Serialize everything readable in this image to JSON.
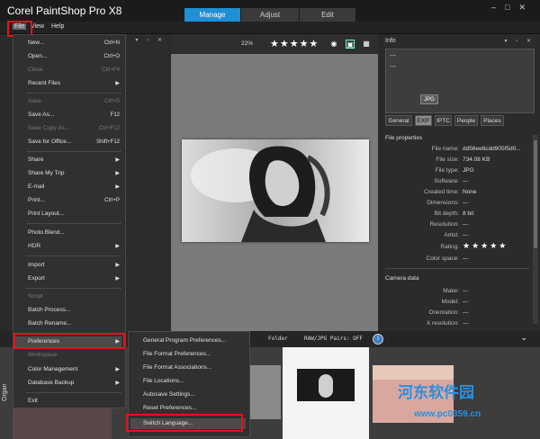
{
  "app": {
    "title": "Corel PaintShop Pro X8"
  },
  "mode_tabs": [
    {
      "label": "Manage",
      "active": true
    },
    {
      "label": "Adjust",
      "active": false
    },
    {
      "label": "Edit",
      "active": false
    }
  ],
  "window_controls": [
    "–",
    "□",
    "✕"
  ],
  "menubar": {
    "file": "File",
    "view": "View",
    "help": "Help"
  },
  "file_menu": {
    "new": {
      "label": "New...",
      "shortcut": "Ctrl+N"
    },
    "open": {
      "label": "Open...",
      "shortcut": "Ctrl+O"
    },
    "close": {
      "label": "Close",
      "shortcut": "Ctrl+F4"
    },
    "recent": {
      "label": "Recent Files"
    },
    "save": {
      "label": "Save",
      "shortcut": "Ctrl+S"
    },
    "save_as": {
      "label": "Save As...",
      "shortcut": "F12"
    },
    "save_copy_as": {
      "label": "Save Copy As...",
      "shortcut": "Ctrl+F12"
    },
    "save_office": {
      "label": "Save for Office...",
      "shortcut": "Shift+F12"
    },
    "share": {
      "label": "Share"
    },
    "share_trip": {
      "label": "Share My Trip"
    },
    "email": {
      "label": "E-mail"
    },
    "print": {
      "label": "Print...",
      "shortcut": "Ctrl+P"
    },
    "print_layout": {
      "label": "Print Layout..."
    },
    "photo_blend": {
      "label": "Photo Blend..."
    },
    "hdr": {
      "label": "HDR"
    },
    "import": {
      "label": "Import"
    },
    "export": {
      "label": "Export"
    },
    "script": {
      "label": "Script"
    },
    "batch_process": {
      "label": "Batch Process..."
    },
    "batch_rename": {
      "label": "Batch Rename..."
    },
    "preferences": {
      "label": "Preferences"
    },
    "workspace": {
      "label": "Workspace"
    },
    "color_mgmt": {
      "label": "Color Management"
    },
    "db_backup": {
      "label": "Database Backup"
    },
    "exit": {
      "label": "Exit"
    }
  },
  "preferences_submenu": {
    "general": "General Program Preferences...",
    "file_format": "File Format Preferences...",
    "associations": "File Format Associations...",
    "locations": "File Locations...",
    "autosave": "Autosave Settings...",
    "reset": "Reset Preferences...",
    "switch_lang": "Switch Language..."
  },
  "preview": {
    "zoom": "22%",
    "stars": "★★★★★"
  },
  "info_panel": {
    "title": "Info",
    "thumb_line1": "---",
    "thumb_line2": "---",
    "format_badge": "JPG",
    "tabs": [
      {
        "label": "General",
        "active": false
      },
      {
        "label": "EXIF",
        "active": true
      },
      {
        "label": "IPTC",
        "active": false
      },
      {
        "label": "People",
        "active": false
      },
      {
        "label": "Places",
        "active": false
      }
    ],
    "file_props_title": "File properties",
    "file_props": [
      {
        "label": "File name:",
        "value": "dd56ee6cdd905f5d0..."
      },
      {
        "label": "File size:",
        "value": "734.08 KB"
      },
      {
        "label": "File type:",
        "value": "JPG"
      },
      {
        "label": "Software:",
        "value": "---"
      },
      {
        "label": "Created time:",
        "value": "None"
      },
      {
        "label": "Dimensions:",
        "value": "---"
      },
      {
        "label": "Bit depth:",
        "value": "8 bit"
      },
      {
        "label": "Resolution:",
        "value": "---"
      },
      {
        "label": "Artist:",
        "value": "---"
      },
      {
        "label": "Rating:",
        "value": "★★★★★"
      },
      {
        "label": "Color space:",
        "value": "---"
      }
    ],
    "camera_title": "Camera data",
    "camera_props": [
      {
        "label": "Make:",
        "value": "---"
      },
      {
        "label": "Model:",
        "value": "---"
      },
      {
        "label": "Orientation:",
        "value": "---"
      },
      {
        "label": "X resolution:",
        "value": "---"
      }
    ]
  },
  "organizer": {
    "label": "Organ",
    "folder_filter": "Folder",
    "raw_pairs": "RAW/JPG Pairs: OFF",
    "chevron": "⌄"
  },
  "watermark": {
    "text": "河东软件园",
    "url": "www.pc0359.cn"
  },
  "colors": {
    "accent": "#1f8fd6",
    "highlight_box": "#e0151b"
  }
}
